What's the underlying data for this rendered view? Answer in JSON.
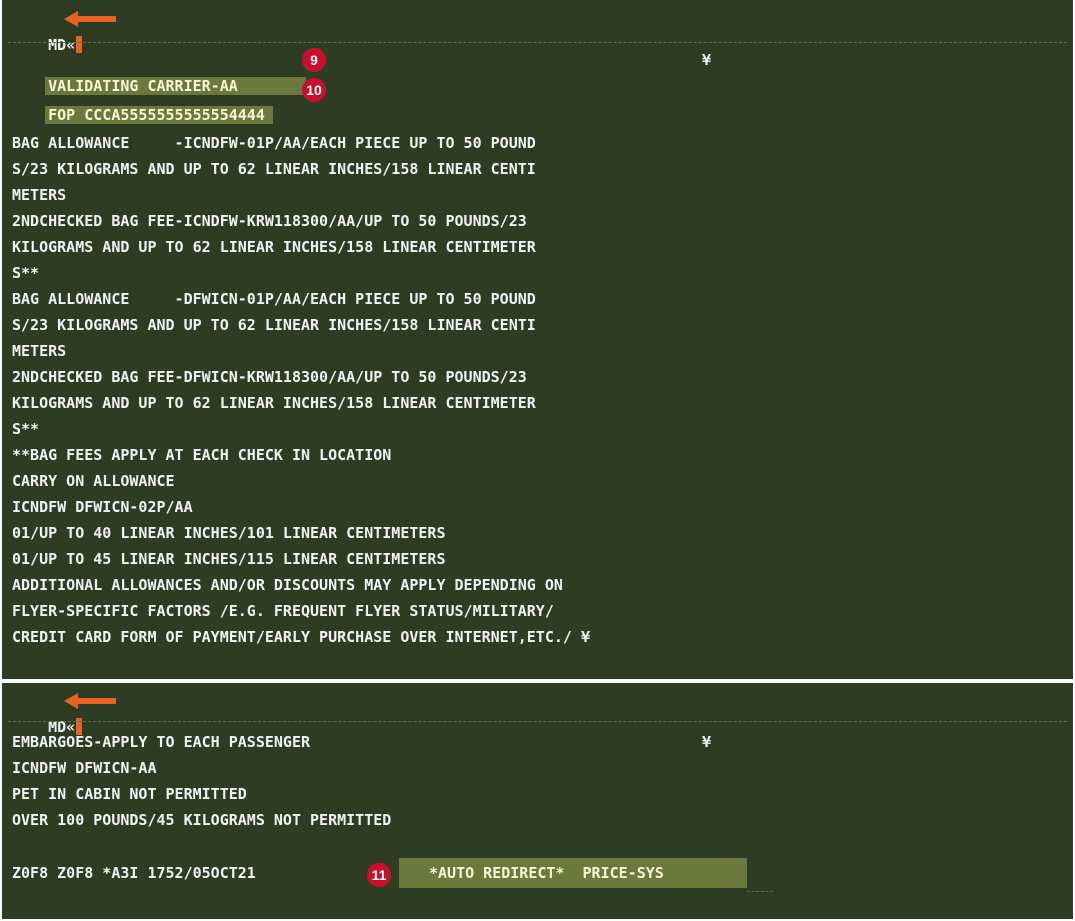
{
  "screen1": {
    "command": "MD«",
    "highlight_lines": [
      "VALIDATING CARRIER-AA",
      "FOP CCCA5555555555554444"
    ],
    "badges": [
      "9",
      "10",
      "11"
    ],
    "yen_marker": "¥",
    "lines": [
      "BAG ALLOWANCE     -ICNDFW-01P/AA/EACH PIECE UP TO 50 POUND",
      "S/23 KILOGRAMS AND UP TO 62 LINEAR INCHES/158 LINEAR CENTI",
      "METERS",
      "2NDCHECKED BAG FEE-ICNDFW-KRW118300/AA/UP TO 50 POUNDS/23",
      "KILOGRAMS AND UP TO 62 LINEAR INCHES/158 LINEAR CENTIMETER",
      "S**",
      "BAG ALLOWANCE     -DFWICN-01P/AA/EACH PIECE UP TO 50 POUND",
      "S/23 KILOGRAMS AND UP TO 62 LINEAR INCHES/158 LINEAR CENTI",
      "METERS",
      "2NDCHECKED BAG FEE-DFWICN-KRW118300/AA/UP TO 50 POUNDS/23",
      "KILOGRAMS AND UP TO 62 LINEAR INCHES/158 LINEAR CENTIMETER",
      "S**",
      "**BAG FEES APPLY AT EACH CHECK IN LOCATION",
      "CARRY ON ALLOWANCE",
      "ICNDFW DFWICN-02P/AA",
      "01/UP TO 40 LINEAR INCHES/101 LINEAR CENTIMETERS",
      "01/UP TO 45 LINEAR INCHES/115 LINEAR CENTIMETERS",
      "ADDITIONAL ALLOWANCES AND/OR DISCOUNTS MAY APPLY DEPENDING ON",
      "FLYER-SPECIFIC FACTORS /E.G. FREQUENT FLYER STATUS/MILITARY/",
      "CREDIT CARD FORM OF PAYMENT/EARLY PURCHASE OVER INTERNET,ETC./ ¥"
    ]
  },
  "screen2": {
    "command": "MD«",
    "yen_marker": "¥",
    "lines": [
      "EMBARGOES-APPLY TO EACH PASSENGER",
      "ICNDFW DFWICN-AA",
      "PET IN CABIN NOT PERMITTED",
      "OVER 100 POUNDS/45 KILOGRAMS NOT PERMITTED"
    ],
    "status_line": "Z0F8 Z0F8 *A3I 1752/05OCT21",
    "redirect_label": "*AUTO REDIRECT*  PRICE-SYS"
  },
  "colors": {
    "terminal_bg": "#2d3c23",
    "highlight_bg": "#6b7a3c",
    "text": "#f2f2f2",
    "arrow": "#e8641e",
    "badge": "#c8102e"
  },
  "icons": [
    "cursor-block",
    "left-arrow-icon",
    "yen-sign"
  ]
}
